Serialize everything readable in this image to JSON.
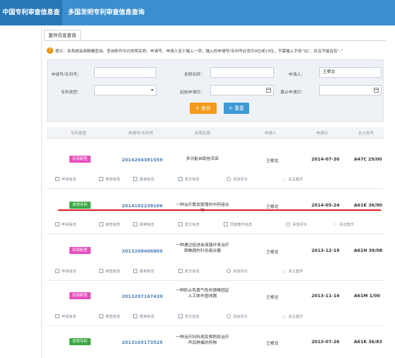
{
  "nav": {
    "tab_active": "中国专利审查信息查询",
    "tab_other": "多国发明专利审查信息查询"
  },
  "subtab": "案件信息查询",
  "notice": "提示：本系统采用精确查询，查询条件中对发明名称、申请号、申请人至少输入一项，输入的申请号/专利号必须为9位或13位，不需输入字母“ZL”，并且不能含有“.”",
  "form": {
    "appno_label": "申请号/专利号：",
    "appno_value": "",
    "title_label": "发明名称：",
    "title_value": "",
    "applicant_label": "申请人：",
    "applicant_value": "王根龙",
    "type_label": "专利类型：",
    "type_value": "",
    "date_from_label": "起始申请日：",
    "date_from_value": "",
    "date_to_label": "截止申请日：",
    "date_to_value": "",
    "query_btn": "查询",
    "reset_btn": "重置"
  },
  "table": {
    "headers": [
      "专利类型",
      "申请号/专利号",
      "发明名称",
      "申请人",
      "申请日",
      "主分类号"
    ],
    "rows": [
      {
        "type": "实用新型",
        "type_color": "#e64fbc",
        "appno": "2014204381559",
        "title": "多功能自助挂吊床",
        "applicant": "王根龙",
        "date": "2014-07-30",
        "ipc": "A47C 29/00"
      },
      {
        "type": "发明专利",
        "type_color": "#3aa745",
        "appno": "2014102239106",
        "title": "一种治疗脱发脱落的中药组合物",
        "applicant": "王根龙",
        "date": "2014-05-24",
        "ipc": "A61K 36/90"
      },
      {
        "type": "实用新型",
        "type_color": "#e64fbc",
        "appno": "2013208406809",
        "title": "一种通过促进血液循环来治疗颈椎病的针灸组合器",
        "applicant": "王根龙",
        "date": "2013-12-19",
        "ipc": "A61H 39/08"
      },
      {
        "type": "实用新型",
        "type_color": "#e64fbc",
        "appno": "201320716743X",
        "title": "一种防止乳糜气性的颈椎固定人工体外固体器",
        "applicant": "王根龙",
        "date": "2013-11-14",
        "ipc": "A61M 1/00"
      },
      {
        "type": "发明专利",
        "type_color": "#3aa745",
        "appno": "2013103173525",
        "title": "一种治疗妇科病及预防和治疗声后肿痛的药物",
        "applicant": "王根龙",
        "date": "2013-07-26",
        "ipc": "A61K 36/83"
      }
    ]
  },
  "actions": {
    "a1": "申请信息",
    "a2": "审查信息",
    "a3": "费用信息",
    "a4": "发文信息",
    "a5": "添加评论",
    "a5b": "同族案件信息",
    "a6": "关注案件"
  }
}
